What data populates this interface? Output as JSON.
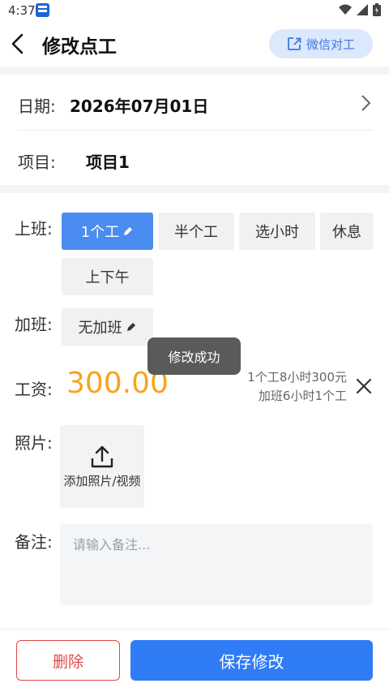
{
  "status_bar": {
    "time": "4:37"
  },
  "header": {
    "title": "修改点工",
    "wechat_button": "微信对工"
  },
  "date": {
    "label": "日期:",
    "value": "2026年07月01日"
  },
  "project": {
    "label": "项目:",
    "value": "项目1"
  },
  "work": {
    "label": "上班:",
    "options": [
      "1个工",
      "半个工",
      "选小时",
      "休息",
      "上下午"
    ],
    "selected_index": 0
  },
  "overtime": {
    "label": "加班:",
    "value": "无加班"
  },
  "toast": "修改成功",
  "wage": {
    "label": "工资:",
    "amount": "300.00",
    "desc_line1": "1个工8小时300元",
    "desc_line2": "加班6小时1个工",
    "amount_color": "#f6a51c"
  },
  "photos": {
    "label": "照片:",
    "add_text": "添加照片/视频"
  },
  "note": {
    "label": "备注:",
    "placeholder": "请输入备注..."
  },
  "actions": {
    "delete": "删除",
    "save": "保存修改"
  },
  "colors": {
    "accent": "#2f7cf6",
    "danger": "#e04848",
    "chip_active": "#4a8cf0"
  },
  "icons": [
    "back-arrow-icon",
    "share-icon",
    "chevron-right-icon",
    "edit-pencil-icon",
    "close-icon",
    "upload-icon",
    "wifi-icon",
    "signal-icon",
    "battery-icon"
  ]
}
